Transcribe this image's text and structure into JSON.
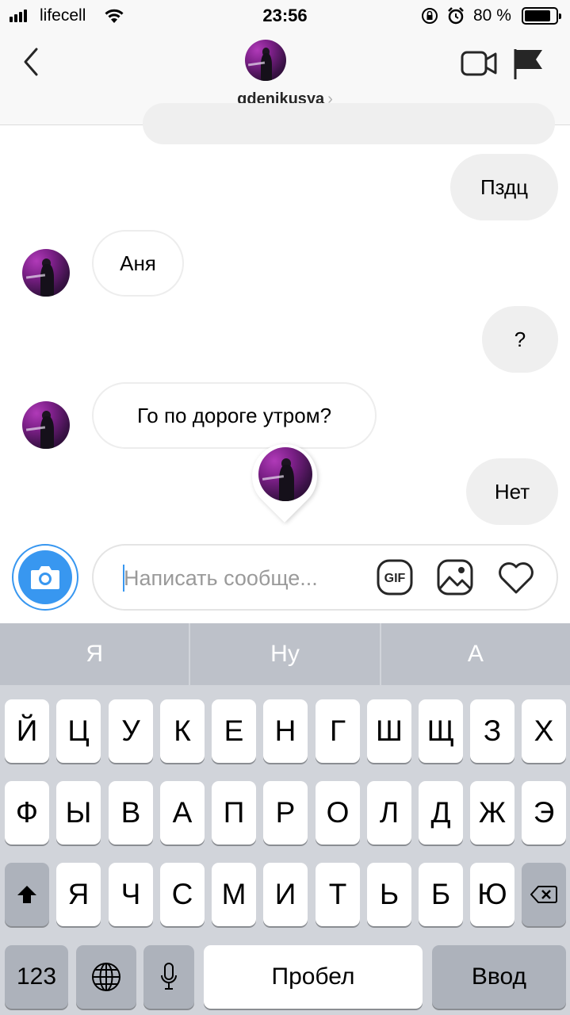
{
  "status_bar": {
    "carrier": "lifecell",
    "time": "23:56",
    "battery": "80 %"
  },
  "header": {
    "username": "gdenikusya",
    "chevron": "›",
    "icons": [
      "back-chevron-icon",
      "video-call-icon",
      "flag-icon"
    ]
  },
  "messages": [
    {
      "side": "out",
      "text": "Пздц"
    },
    {
      "side": "in",
      "text": "Аня"
    },
    {
      "side": "out",
      "text": "?"
    },
    {
      "side": "in",
      "text": "Го по дороге утром?"
    },
    {
      "side": "out",
      "text": "Нет"
    }
  ],
  "composer": {
    "placeholder": "Написать сообще...",
    "icons": [
      "camera-icon",
      "gif-icon",
      "gallery-icon",
      "heart-icon"
    ]
  },
  "keyboard": {
    "suggestions": [
      "Я",
      "Ну",
      "А"
    ],
    "row1": [
      "Й",
      "Ц",
      "У",
      "К",
      "Е",
      "Н",
      "Г",
      "Ш",
      "Щ",
      "З",
      "Х"
    ],
    "row2": [
      "Ф",
      "Ы",
      "В",
      "А",
      "П",
      "Р",
      "О",
      "Л",
      "Д",
      "Ж",
      "Э"
    ],
    "row3": [
      "Я",
      "Ч",
      "С",
      "М",
      "И",
      "Т",
      "Ь",
      "Б",
      "Ю"
    ],
    "numbers_label": "123",
    "space_label": "Пробел",
    "return_label": "Ввод"
  },
  "colors": {
    "accent": "#3897f0",
    "bubble_out": "#efefef",
    "keyboard_bg": "#d1d4da"
  }
}
